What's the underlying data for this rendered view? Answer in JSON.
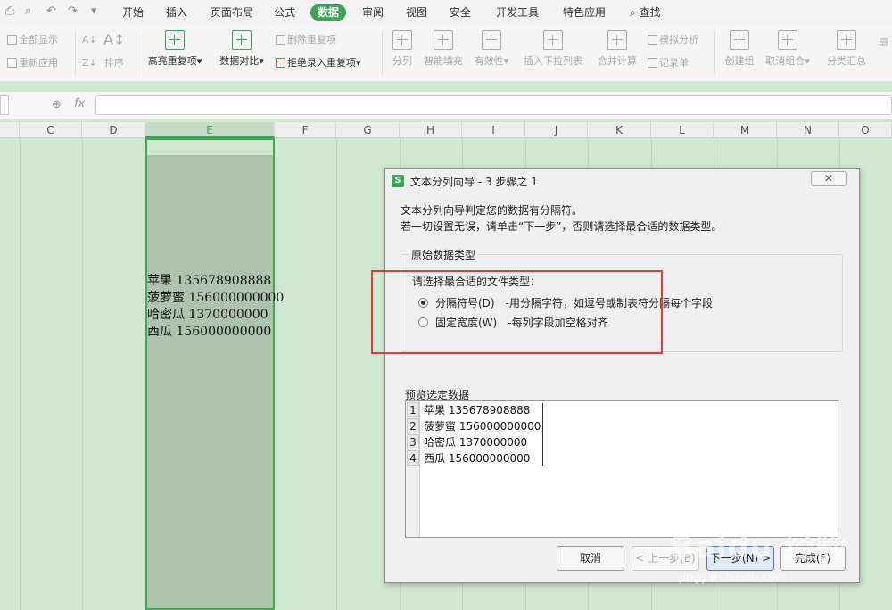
{
  "menu": {
    "tabs": [
      "开始",
      "插入",
      "页面布局",
      "公式",
      "数据",
      "审阅",
      "视图",
      "安全",
      "开发工具",
      "特色应用"
    ],
    "active_tab": "数据",
    "search_label": "查找"
  },
  "ribbon": {
    "show_all": "全部显示",
    "reapply": "重新应用",
    "sort": "排序",
    "highlight_dup": "高亮重复项",
    "data_compare": "数据对比",
    "delete_dup": "删除重复项",
    "reject_dup": "拒绝录入重复项",
    "split": "分列",
    "smart_fill": "智能填充",
    "validity": "有效性",
    "insert_dropdown": "插入下拉列表",
    "merge_calc": "合并计算",
    "simulate": "模拟分析",
    "record_form": "记录单",
    "create_group": "创建组",
    "ungroup": "取消组合",
    "subtotal": "分类汇总"
  },
  "formula_bar": {
    "fx": "fx",
    "value": ""
  },
  "columns": [
    "C",
    "D",
    "E",
    "F",
    "G",
    "H",
    "I",
    "J",
    "K",
    "L",
    "M",
    "N",
    "O"
  ],
  "selected_column": "E",
  "cells": [
    "苹果 135678908888",
    "菠萝蜜 156000000000",
    "哈密瓜 1370000000",
    "西瓜 156000000000"
  ],
  "dialog": {
    "app_icon": "S",
    "title": "文本分列向导 - 3 步骤之 1",
    "close": "✕",
    "intro1": "文本分列向导判定您的数据有分隔符。",
    "intro2": "若一切设置无误，请单击“下一步”，否则请选择最合适的数据类型。",
    "group_label": "原始数据类型",
    "choose_label": "请选择最合适的文件类型：",
    "options": [
      {
        "label": "分隔符号(D)",
        "desc": "-用分隔字符，如逗号或制表符分隔每个字段",
        "checked": true
      },
      {
        "label": "固定宽度(W)",
        "desc": "-每列字段加空格对齐",
        "checked": false
      }
    ],
    "preview_label": "预览选定数据",
    "preview_rows": [
      "苹果 135678908888",
      "菠萝蜜 156000000000",
      "哈密瓜 1370000000",
      "西瓜 156000000000"
    ],
    "preview_nums": [
      "1",
      "2",
      "3",
      "4"
    ],
    "buttons": {
      "cancel": "取消",
      "prev": "< 上一步(B)",
      "next": "下一步(N) >",
      "finish": "完成(F)"
    }
  },
  "watermark": {
    "text": "Baidu 经验",
    "url": "jingyan.baidu.com"
  }
}
